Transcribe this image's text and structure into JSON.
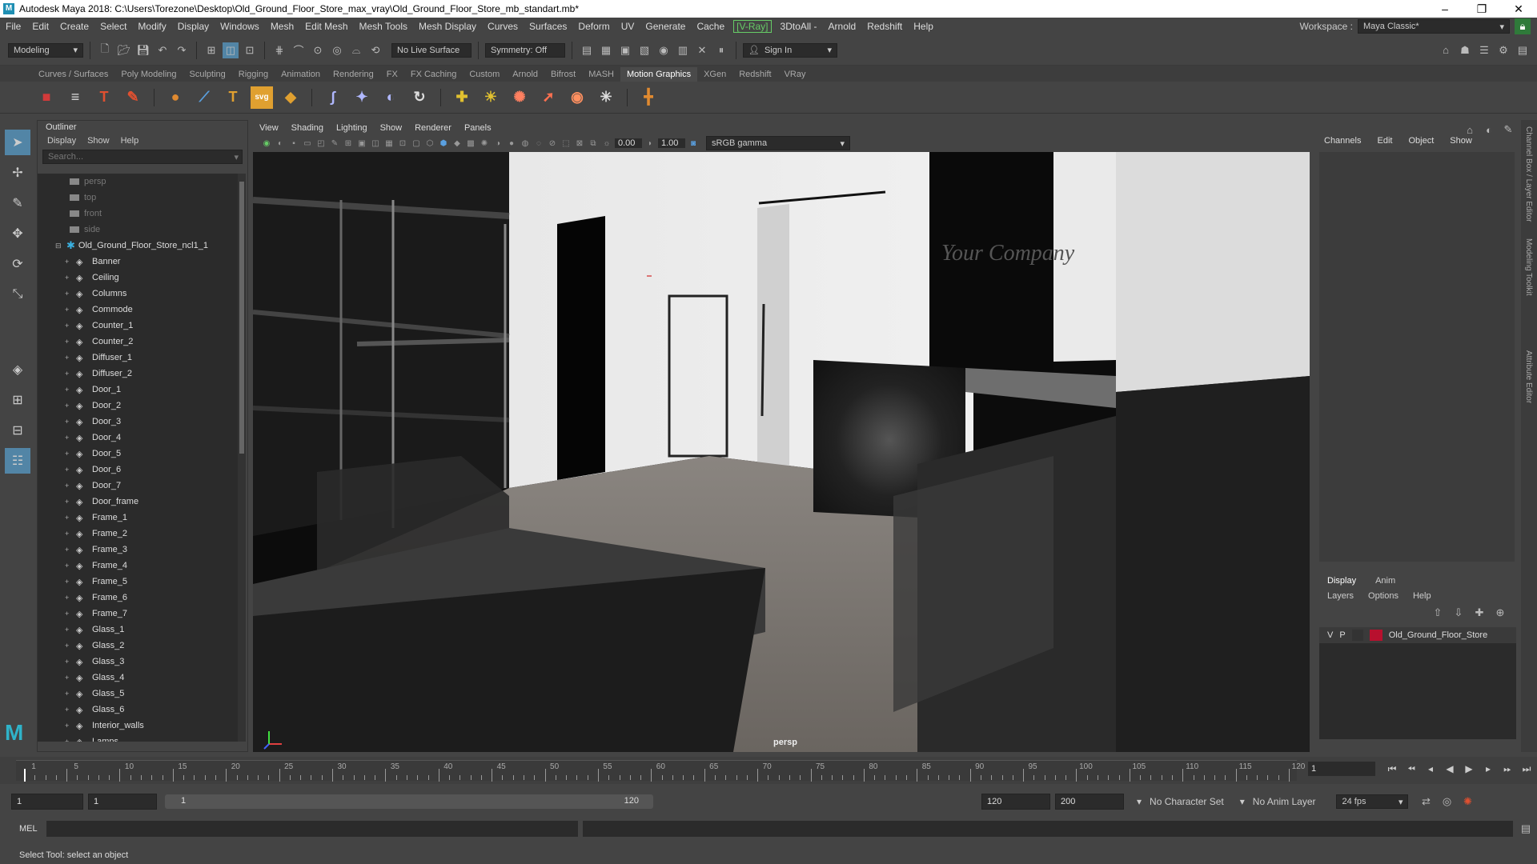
{
  "window": {
    "title": "Autodesk Maya 2018: C:\\Users\\Torezone\\Desktop\\Old_Ground_Floor_Store_max_vray\\Old_Ground_Floor_Store_mb_standart.mb*"
  },
  "menubar": {
    "items": [
      "File",
      "Edit",
      "Create",
      "Select",
      "Modify",
      "Display",
      "Windows",
      "Mesh",
      "Edit Mesh",
      "Mesh Tools",
      "Mesh Display",
      "Curves",
      "Surfaces",
      "Deform",
      "UV",
      "Generate",
      "Cache",
      "[V-Ray]",
      "3DtoAll -",
      "Arnold",
      "Redshift",
      "Help"
    ],
    "workspace_label": "Workspace :",
    "workspace_value": "Maya Classic*"
  },
  "statusline": {
    "mode": "Modeling",
    "live_surface": "No Live Surface",
    "symmetry": "Symmetry: Off",
    "sign_in": "Sign In"
  },
  "shelf": {
    "tabs": [
      "Curves / Surfaces",
      "Poly Modeling",
      "Sculpting",
      "Rigging",
      "Animation",
      "Rendering",
      "FX",
      "FX Caching",
      "Custom",
      "Arnold",
      "Bifrost",
      "MASH",
      "Motion Graphics",
      "XGen",
      "Redshift",
      "VRay"
    ],
    "active_tab": "Motion Graphics",
    "icons": [
      {
        "glyph": "■",
        "color": "#d23a3a"
      },
      {
        "glyph": "≡",
        "color": "#ddd"
      },
      {
        "glyph": "T",
        "color": "#e05030"
      },
      {
        "glyph": "✎",
        "color": "#e05030"
      },
      {
        "glyph": "●",
        "color": "#e08a30"
      },
      {
        "glyph": "⟋",
        "color": "#5aa0e0"
      },
      {
        "glyph": "T",
        "color": "#e0a030"
      },
      {
        "glyph": "svg",
        "color": "#e0a030"
      },
      {
        "glyph": "◆",
        "color": "#e0a030"
      },
      {
        "glyph": "∫",
        "color": "#b0b8ff"
      },
      {
        "glyph": "✦",
        "color": "#b0b8ff"
      },
      {
        "glyph": "◐",
        "color": "#b0b8ff"
      },
      {
        "glyph": "↻",
        "color": "#ddd"
      },
      {
        "glyph": "✚",
        "color": "#e0c030"
      },
      {
        "glyph": "☀",
        "color": "#e0c030"
      },
      {
        "glyph": "✺",
        "color": "#ff8060"
      },
      {
        "glyph": "➚",
        "color": "#ff7050"
      },
      {
        "glyph": "◉",
        "color": "#ff9060"
      },
      {
        "glyph": "✳",
        "color": "#ddd"
      },
      {
        "glyph": "╋",
        "color": "#e08a30"
      }
    ]
  },
  "outliner": {
    "title": "Outliner",
    "menu": [
      "Display",
      "Show",
      "Help"
    ],
    "search_placeholder": "Search...",
    "cameras": [
      "persp",
      "top",
      "front",
      "side"
    ],
    "root": "Old_Ground_Floor_Store_ncl1_1",
    "children": [
      "Banner",
      "Ceiling",
      "Columns",
      "Commode",
      "Counter_1",
      "Counter_2",
      "Diffuser_1",
      "Diffuser_2",
      "Door_1",
      "Door_2",
      "Door_3",
      "Door_4",
      "Door_5",
      "Door_6",
      "Door_7",
      "Door_frame",
      "Frame_1",
      "Frame_2",
      "Frame_3",
      "Frame_4",
      "Frame_5",
      "Frame_6",
      "Frame_7",
      "Glass_1",
      "Glass_2",
      "Glass_3",
      "Glass_4",
      "Glass_5",
      "Glass_6",
      "Interior_walls",
      "Lamps"
    ]
  },
  "viewport": {
    "menu": [
      "View",
      "Shading",
      "Lighting",
      "Show",
      "Renderer",
      "Panels"
    ],
    "near_value": "0.00",
    "far_value": "1.00",
    "color_space": "sRGB gamma",
    "camera_label": "persp",
    "sign_text": "Your Company"
  },
  "channelbox": {
    "tabs": [
      "Channels",
      "Edit",
      "Object",
      "Show"
    ],
    "side_tabs": [
      "Channel Box / Layer Editor",
      "Modeling Toolkit",
      "Attribute Editor"
    ]
  },
  "layers": {
    "tabs": [
      "Display",
      "Anim"
    ],
    "active_tab": "Display",
    "menu": [
      "Layers",
      "Options",
      "Help"
    ],
    "layer": {
      "v": "V",
      "p": "P",
      "name": "Old_Ground_Floor_Store",
      "color": "#b8102e"
    }
  },
  "timeline": {
    "labels": [
      "1",
      "5",
      "10",
      "15",
      "20",
      "25",
      "30",
      "35",
      "40",
      "45",
      "50",
      "55",
      "60",
      "65",
      "70",
      "75",
      "80",
      "85",
      "90",
      "95",
      "100",
      "105",
      "110",
      "115",
      "120"
    ],
    "current_frame": "1"
  },
  "range": {
    "start": "1",
    "playback_start": "1",
    "range_left": "1",
    "range_right": "120",
    "playback_end": "120",
    "end": "200",
    "character_set": "No Character Set",
    "anim_layer": "No Anim Layer",
    "fps": "24 fps"
  },
  "command": {
    "mel_label": "MEL"
  },
  "help_line": "Select Tool: select an object"
}
